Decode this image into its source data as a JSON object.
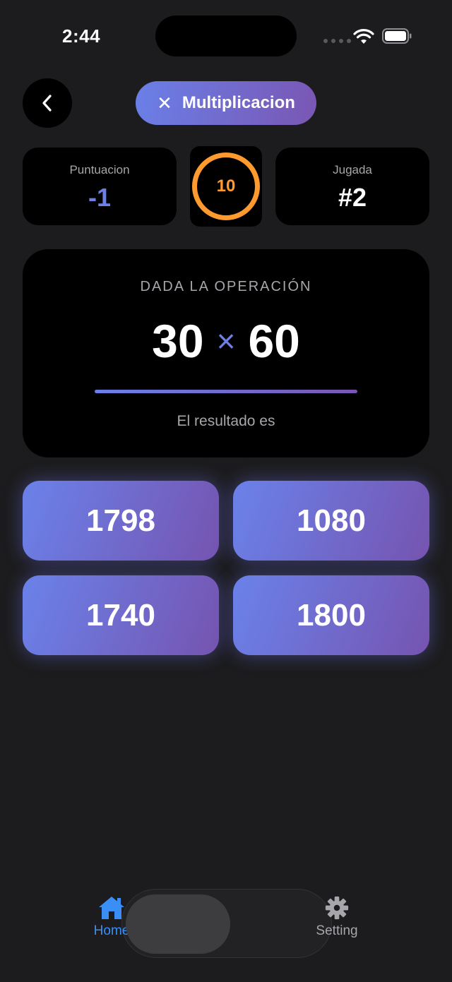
{
  "status": {
    "time": "2:44"
  },
  "header": {
    "title": "Multiplicacion",
    "close_glyph": "✕",
    "back_icon": "chevron-left-icon",
    "gradient": [
      "#6a80e8",
      "#7a56b3"
    ]
  },
  "stats": {
    "score_label": "Puntuacion",
    "score_value": "-1",
    "timer_value": "10",
    "timer_color": "#ff9a2e",
    "play_label": "Jugada",
    "play_value": "#2"
  },
  "question": {
    "label": "DADA LA OPERACIÓN",
    "left": "30",
    "operator": "×",
    "right": "60",
    "subtitle": "El resultado es"
  },
  "answers": [
    "1798",
    "1080",
    "1740",
    "1800"
  ],
  "tabbar": {
    "home_label": "Home",
    "setting_label": "Setting",
    "home_icon": "house-icon",
    "setting_icon": "gear-icon",
    "active_color": "#3a8ff6"
  }
}
